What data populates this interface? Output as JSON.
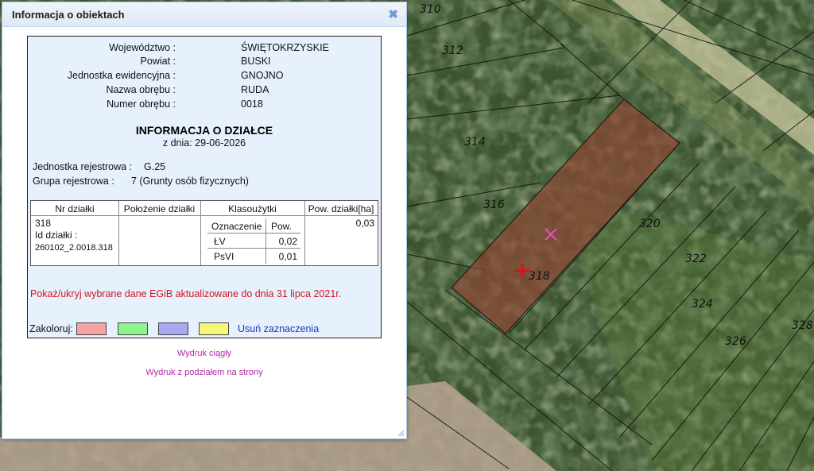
{
  "dialog": {
    "title": "Informacja o obiektach",
    "close_icon": "✖"
  },
  "location": {
    "items": [
      {
        "label": "Województwo :",
        "value": "ŚWIĘTOKRZYSKIE"
      },
      {
        "label": "Powiat :",
        "value": "BUSKI"
      },
      {
        "label": "Jednostka ewidencyjna :",
        "value": "GNOJNO"
      },
      {
        "label": "Nazwa obrębu :",
        "value": "RUDA"
      },
      {
        "label": "Numer obrębu :",
        "value": "0018"
      }
    ]
  },
  "section": {
    "title": "INFORMACJA O DZIAŁCE",
    "date": "z dnia: 29-06-2026"
  },
  "registry": {
    "unit_label": "Jednostka rejestrowa :",
    "unit_value": "G.25",
    "group_label": "Grupa rejestrowa :",
    "group_value": "7 (Grunty osób fizycznych)"
  },
  "table": {
    "headers": [
      "Nr działki",
      "Położenie działki",
      "Klasoużytki",
      "Pow. działki[ha]"
    ],
    "parcel_number": "318",
    "parcel_id_label": "Id działki :",
    "parcel_id": "260102_2.0018.318",
    "location_value": "",
    "area": "0,03",
    "land_use": {
      "headers": [
        "Oznaczenie",
        "Pow."
      ],
      "rows": [
        {
          "code": "ŁV",
          "area": "0,02"
        },
        {
          "code": "PsVI",
          "area": "0,01"
        }
      ]
    }
  },
  "egib_link": "Pokaż/ukryj wybrane dane EGiB aktualizowane do dnia 31 lipca 2021r.",
  "coloring": {
    "label": "Zakoloruj:",
    "swatches": [
      "#f6a3a3",
      "#8ef58e",
      "#a9a9f2",
      "#f6f67a"
    ],
    "clear_label": "Usuń zaznaczenia"
  },
  "print": {
    "continuous": "Wydruk ciągły",
    "paged": "Wydruk z podziałem na strony"
  },
  "map": {
    "parcel_labels": [
      "310",
      "312",
      "314",
      "316",
      "318",
      "320",
      "322",
      "324",
      "326",
      "328"
    ],
    "marker_icons": [
      "pink-x-marker-icon",
      "red-cross-marker-icon"
    ],
    "selection_color": "#8c4633"
  }
}
